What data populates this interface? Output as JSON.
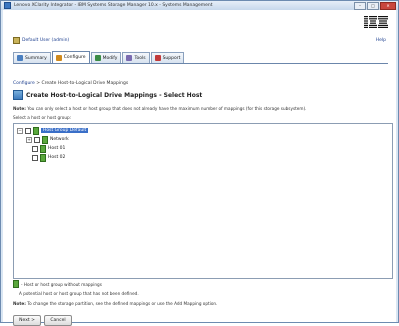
{
  "window": {
    "title": "Lenovo XClarity Integrator - IBM Systems Storage Manager 10.x - Systems Management",
    "controls": [
      "–",
      "□",
      "✕"
    ]
  },
  "header": {
    "user_link": "Default User (admin)",
    "help_link": "Help",
    "logo_text": "IBM"
  },
  "tabs": [
    {
      "label": "Summary",
      "icon": "summary-icon",
      "color": "#4a7fc0"
    },
    {
      "label": "Configure",
      "icon": "configure-icon",
      "color": "#d08a1e"
    },
    {
      "label": "Modify",
      "icon": "modify-icon",
      "color": "#3b8c45"
    },
    {
      "label": "Tools",
      "icon": "tools-icon",
      "color": "#7a6bb0"
    },
    {
      "label": "Support",
      "icon": "support-icon",
      "color": "#c23a3a"
    }
  ],
  "breadcrumb": {
    "link": "Configure",
    "separator": " > ",
    "current": "Create Host-to-Logical Drive Mappings"
  },
  "page": {
    "title": "Create Host-to-Logical Drive Mappings - Select Host",
    "note1_bold": "Note:",
    "note1_text": " You can only select a host or host group that does not already have the maximum number of mappings (for this storage subsystem).",
    "select_prompt": "Select a host or host group:",
    "legend_text": "- Host or host group without mappings",
    "warning_text": "A potential host or host group that has not been defined.",
    "note2_bold": "Note:",
    "note2_text": " To change the storage partition, see the defined mappings or use the Add Mapping option."
  },
  "tree": {
    "root": {
      "label": "Host Group Default"
    },
    "children": [
      {
        "label": "Network"
      },
      {
        "label": "Host 01"
      },
      {
        "label": "Host 02"
      }
    ]
  },
  "buttons": {
    "next": "Next >",
    "cancel": "Cancel"
  }
}
